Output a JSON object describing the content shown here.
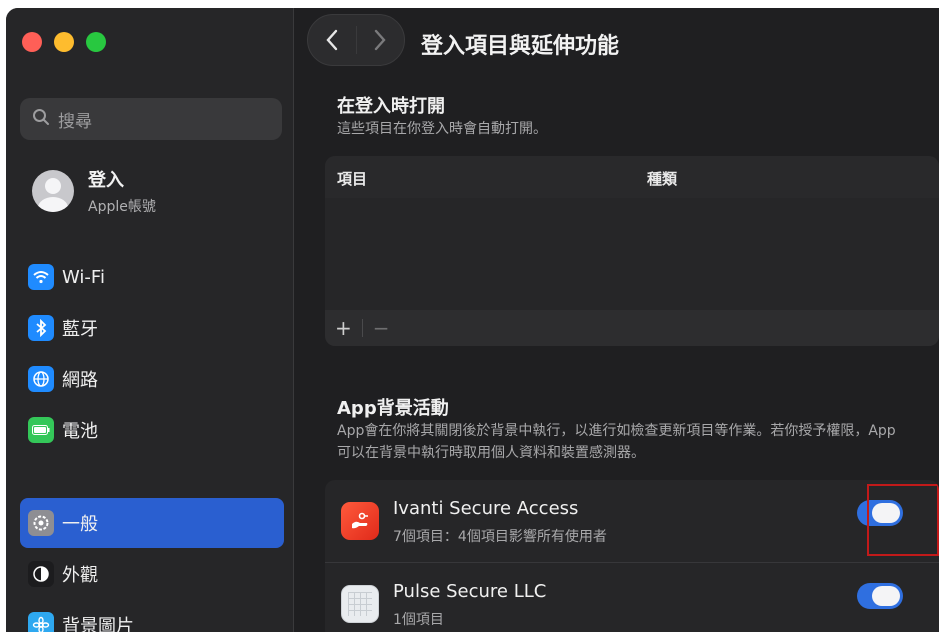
{
  "window": {
    "title": "登入項目與延伸功能"
  },
  "sidebar": {
    "search_placeholder": "搜尋",
    "account": {
      "name": "登入",
      "subtitle": "Apple帳號"
    },
    "items": [
      {
        "label": "Wi-Fi",
        "icon": "wifi-icon",
        "color": "#1f8bff"
      },
      {
        "label": "藍牙",
        "icon": "bluetooth-icon",
        "color": "#1f8bff"
      },
      {
        "label": "網路",
        "icon": "globe-icon",
        "color": "#1f8bff"
      },
      {
        "label": "電池",
        "icon": "battery-icon",
        "color": "#34c759"
      },
      {
        "label": "一般",
        "icon": "gear-icon",
        "color": "#8e8e93",
        "active": true
      },
      {
        "label": "外觀",
        "icon": "appearance-icon",
        "color": "#1c1c1e"
      },
      {
        "label": "背景圖片",
        "icon": "wallpaper-icon",
        "color": "#2ea8f0"
      }
    ]
  },
  "login_items": {
    "title": "在登入時打開",
    "description": "這些項目在你登入時會自動打開。",
    "columns": [
      "項目",
      "種類"
    ],
    "add_label": "+",
    "remove_label": "−"
  },
  "background": {
    "title": "App背景活動",
    "description_line1": "App會在你將其關閉後於背景中執行，以進行如檢查更新項目等作業。若你授予權限，App",
    "description_line2": "可以在背景中執行時取用個人資料和裝置感測器。",
    "apps": [
      {
        "name": "Ivanti Secure Access",
        "subtitle": "7個項目：4個項目影響所有使用者",
        "enabled": true,
        "highlighted": true,
        "accent": "#ff4a2e"
      },
      {
        "name": "Pulse Secure LLC",
        "subtitle": "1個項目",
        "enabled": true
      }
    ]
  },
  "colors": {
    "accent": "#2f6fe0",
    "sidebar_active": "#2a5fd0",
    "highlight_box": "#c21a1a"
  }
}
